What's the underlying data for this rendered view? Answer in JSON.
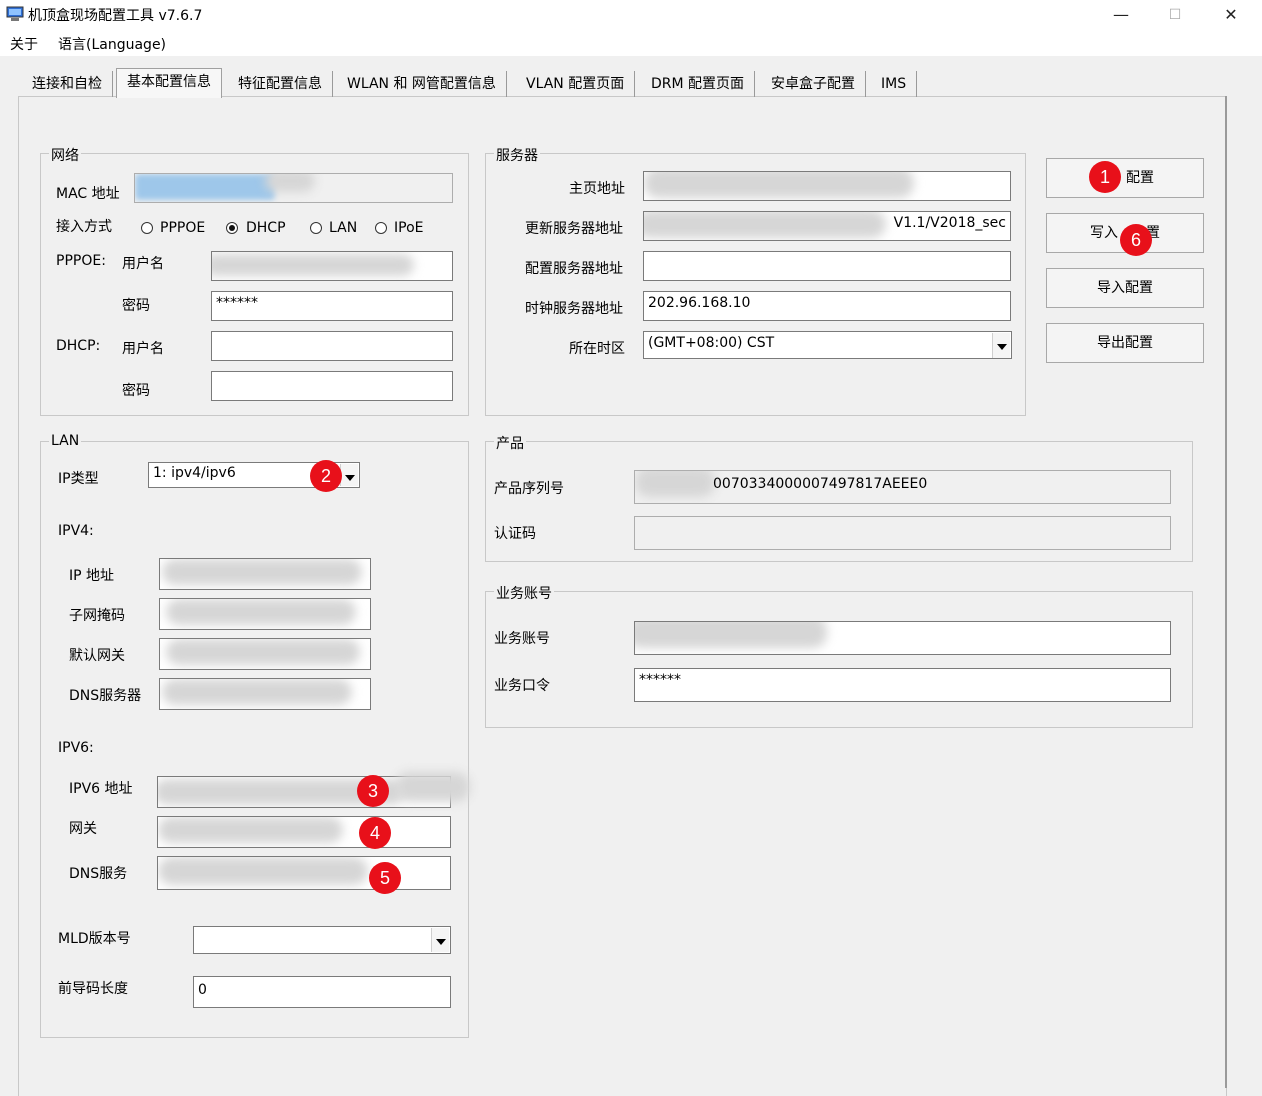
{
  "window": {
    "title": "机顶盒现场配置工具 v7.6.7",
    "minimize": "—",
    "maximize": "☐",
    "close": "✕"
  },
  "menu": [
    {
      "label": "关于"
    },
    {
      "label": "语言(Language)"
    }
  ],
  "tabs": [
    {
      "label": "连接和自检"
    },
    {
      "label": "基本配置信息",
      "active": true
    },
    {
      "label": "特征配置信息"
    },
    {
      "label": "WLAN 和 网管配置信息"
    },
    {
      "label": "VLAN 配置页面"
    },
    {
      "label": "DRM 配置页面"
    },
    {
      "label": "安卓盒子配置"
    },
    {
      "label": "IMS"
    }
  ],
  "network": {
    "title": "网络",
    "mac_label": "MAC 地址",
    "access_label": "接入方式",
    "access_options": [
      {
        "label": "PPPOE",
        "selected": false
      },
      {
        "label": "DHCP",
        "selected": true
      },
      {
        "label": "LAN",
        "selected": false
      },
      {
        "label": "IPoE",
        "selected": false
      }
    ],
    "pppoe_label": "PPPOE:",
    "username_label": "用户名",
    "password_label": "密码",
    "pppoe_password": "******",
    "dhcp_label": "DHCP:",
    "dhcp_username_label": "用户名",
    "dhcp_password_label": "密码"
  },
  "server": {
    "title": "服务器",
    "home_label": "主页地址",
    "update_label": "更新服务器地址",
    "update_value": "V1.1/V2018_sec",
    "config_label": "配置服务器地址",
    "clock_label": "时钟服务器地址",
    "clock_value": "202.96.168.10",
    "tz_label": "所在时区",
    "tz_value": "(GMT+08:00) CST"
  },
  "buttons": {
    "read_label": "配置",
    "write_label_a": "写入",
    "write_label_b": "置",
    "import_label": "导入配置",
    "export_label": "导出配置"
  },
  "lan": {
    "title": "LAN",
    "ip_type_label": "IP类型",
    "ip_type_value": "1: ipv4/ipv6",
    "ipv4_header": "IPV4:",
    "ip_label": "IP 地址",
    "mask_label": "子网掩码",
    "gateway_label": "默认网关",
    "dns_label": "DNS服务器",
    "ipv6_header": "IPV6:",
    "ipv6_addr_label": "IPV6 地址",
    "ipv6_gw_label": "网关",
    "ipv6_dns_label": "DNS服务",
    "mld_label": "MLD版本号",
    "prefix_label": "前导码长度",
    "prefix_value": "0"
  },
  "product": {
    "title": "产品",
    "serial_label": "产品序列号",
    "serial_value": "0070334000007497817AEEE0",
    "auth_label": "认证码"
  },
  "account": {
    "title": "业务账号",
    "account_label": "业务账号",
    "password_label": "业务口令",
    "password_value": "******"
  },
  "markers": [
    "1",
    "2",
    "3",
    "4",
    "5",
    "6"
  ],
  "colors": {
    "marker": "#e8101a",
    "icon_blue": "#2f6fd6"
  }
}
